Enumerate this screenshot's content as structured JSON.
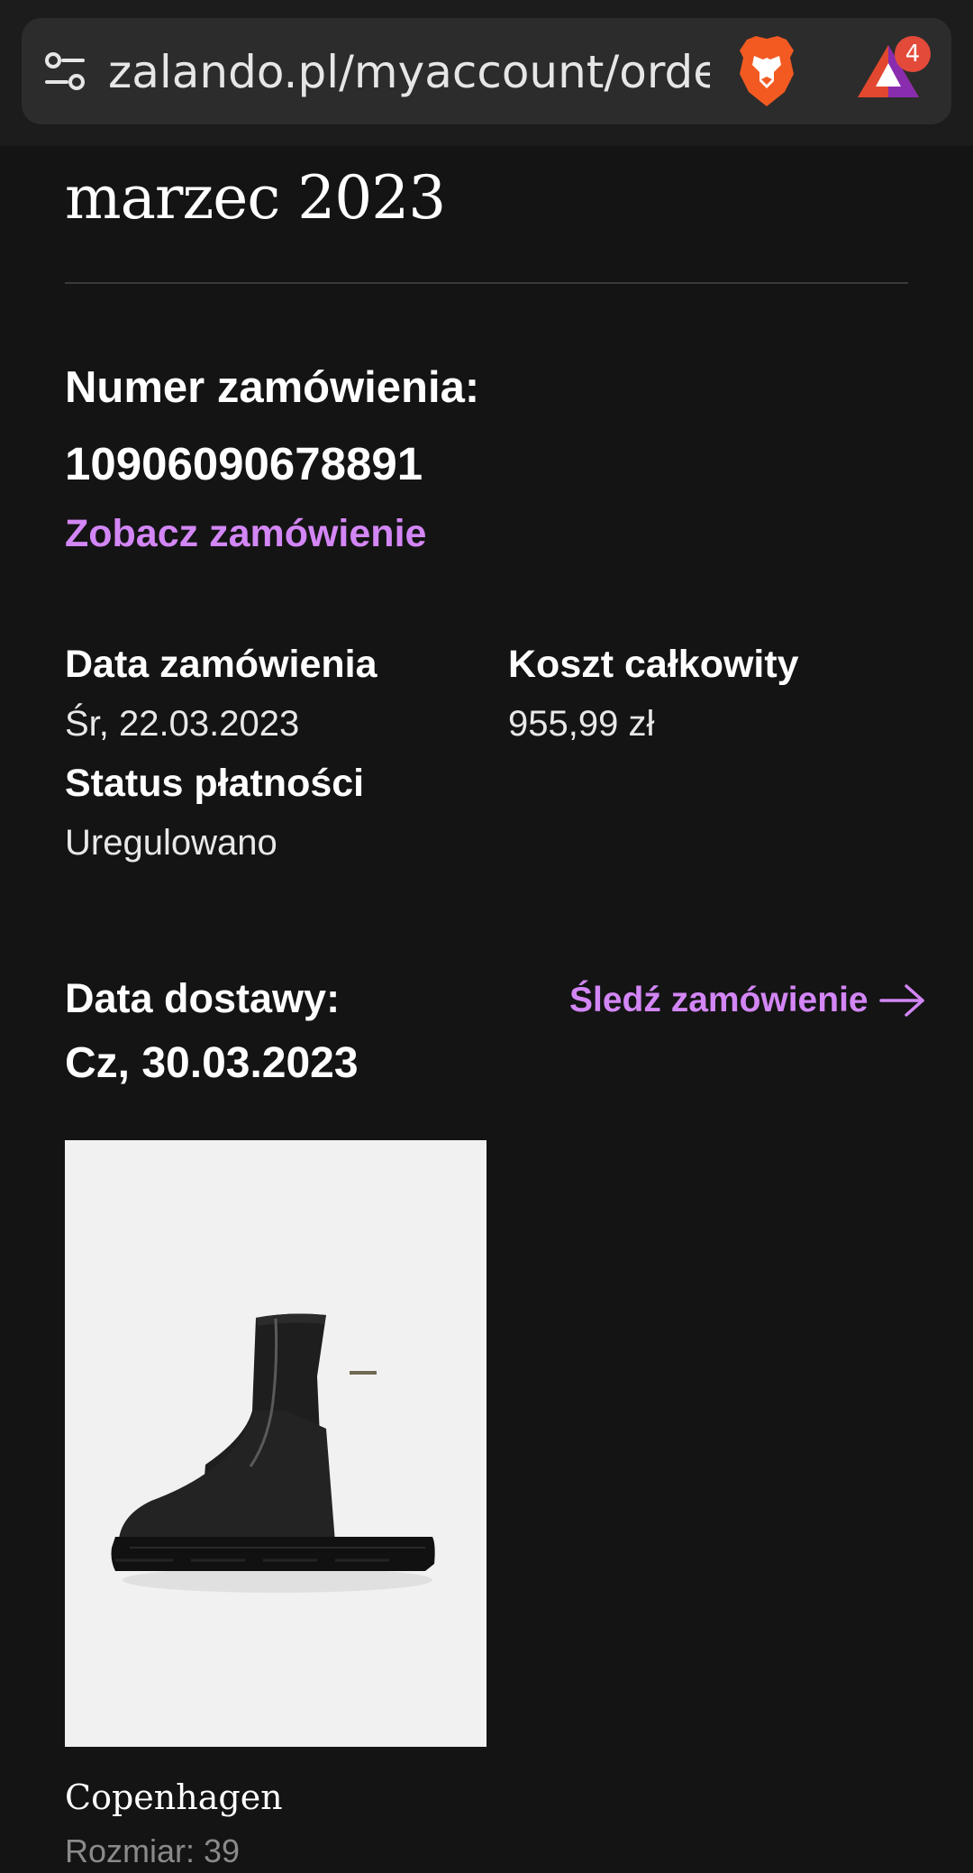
{
  "browser": {
    "url": "zalando.pl/myaccount/orde",
    "rewards_badge_count": "4"
  },
  "orders": {
    "month_heading": "marzec 2023",
    "order_number_label": "Numer zamówienia:",
    "order_number": "10906090678891",
    "view_order_label": "Zobacz zamówienie",
    "order_date_label": "Data zamówienia",
    "order_date_value": "Śr, 22.03.2023",
    "total_cost_label": "Koszt całkowity",
    "total_cost_value": "955,99 zł",
    "payment_status_label": "Status płatności",
    "payment_status_value": "Uregulowano",
    "delivery_date_label": "Data dostawy:",
    "delivery_date_value": "Cz, 30.03.2023",
    "track_order_label": "Śledź zamówienie",
    "product": {
      "brand": "Copenhagen",
      "size_text": "Rozmiar: 39"
    }
  },
  "colors": {
    "background": "#141414",
    "link_accent": "#d386f5",
    "badge_red": "#e34a3a",
    "brave_orange": "#f25a22"
  },
  "icons": [
    "tune-icon",
    "brave-lion-icon",
    "brave-rewards-icon",
    "arrow-right-icon"
  ]
}
